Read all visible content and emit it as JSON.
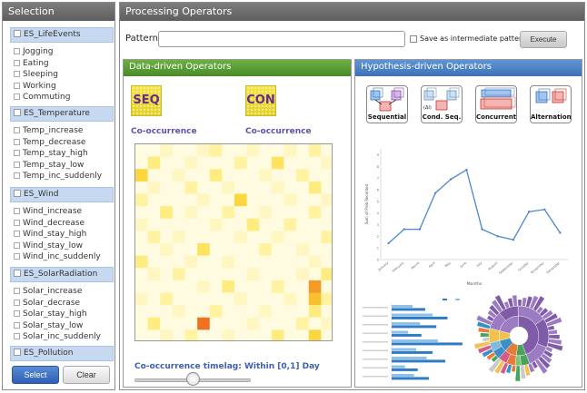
{
  "selection": {
    "title": "Selection",
    "categories": [
      {
        "label": "ES_LifeEvents",
        "items": [
          "Jogging",
          "Eating",
          "Sleeping",
          "Working",
          "Commuting"
        ]
      },
      {
        "label": "ES_Temperature",
        "items": [
          "Temp_increase",
          "Temp_decrease",
          "Temp_stay_high",
          "Temp_stay_low",
          "Temp_inc_suddenly"
        ]
      },
      {
        "label": "ES_Wind",
        "items": [
          "Wind_increase",
          "Wind_decrease",
          "Wind_stay_high",
          "Wind_stay_low",
          "Wind_inc_suddenly"
        ]
      },
      {
        "label": "ES_SolarRadiation",
        "items": [
          "Solar_increase",
          "Solar_decrase",
          "Solar_stay_high",
          "Solar_stay_low",
          "Solar_inc_suddenly"
        ]
      },
      {
        "label": "ES_Pollution",
        "items": []
      }
    ],
    "select_label": "Select",
    "clear_label": "Clear"
  },
  "processing": {
    "title": "Processing Operators",
    "pattern_label": "Pattern:",
    "pattern_value": "",
    "save_label": "Save as intermediate pattern?",
    "execute_label": "Execute"
  },
  "data_driven": {
    "title": "Data-driven Operators",
    "ops": [
      {
        "code": "SEQ",
        "label": "Co-occurrence"
      },
      {
        "code": "CON",
        "label": "Co-occurrence"
      }
    ],
    "timelag_label": "Co-occurrence timelag: Within [0,1] Day",
    "slider_fraction": 0.5
  },
  "hypothesis_driven": {
    "title": "Hypothesis-driven Operators",
    "ops": [
      {
        "label": "Sequential",
        "icon": "sequential-icon"
      },
      {
        "label": "Cond. Seq.",
        "icon": "cond-seq-icon",
        "tag": "(ΔI)"
      },
      {
        "label": "Concurrent",
        "icon": "concurrent-icon"
      },
      {
        "label": "Alternation",
        "icon": "alternation-icon"
      }
    ]
  },
  "chart_data": [
    {
      "type": "line",
      "xlabel": "Months",
      "ylabel": "Sum of Prob Recorded",
      "categories": [
        "January",
        "February",
        "March",
        "April",
        "May",
        "June",
        "July",
        "August",
        "September",
        "October",
        "November",
        "December"
      ],
      "values": [
        1.4,
        2.6,
        2.6,
        5.7,
        6.9,
        7.7,
        2.6,
        2.0,
        1.7,
        4.1,
        4.3,
        2.3
      ],
      "ylim": [
        0,
        9.5
      ],
      "ytick_step": 0.5,
      "color": "#4a86d0"
    },
    {
      "type": "bar",
      "orientation": "horizontal",
      "series": [
        {
          "values": [
            0.28,
            0.55,
            0.38,
            0.22,
            0.62,
            0.33,
            0.47,
            0.18,
            0.3
          ]
        },
        {
          "values": [
            0.45,
            0.75,
            0.6,
            0.4,
            0.95,
            0.55,
            0.72,
            0.35,
            0.5
          ]
        }
      ],
      "colors": [
        "#8fc1e8",
        "#2e7bc6"
      ]
    },
    {
      "type": "sunburst",
      "colors": [
        "#7f5ba8",
        "#9b7cc2",
        "#4aa35a",
        "#e87a3a",
        "#3b8fc7",
        "#c9c9c9",
        "#f2c14e",
        "#d65a8a"
      ]
    }
  ],
  "heatmap": {
    "rows": 16,
    "cols": 16,
    "palette": [
      "#fffbe0",
      "#fff6c2",
      "#fff2a0",
      "#ffec80",
      "#ffe260",
      "#fcd63e",
      "#f8bf2e",
      "#f39a27",
      "#ee7222"
    ],
    "cells": [
      0,
      0,
      1,
      0,
      0,
      1,
      2,
      0,
      0,
      1,
      0,
      0,
      1,
      0,
      2,
      0,
      0,
      3,
      0,
      0,
      1,
      0,
      0,
      0,
      2,
      0,
      0,
      4,
      0,
      0,
      0,
      1,
      5,
      0,
      0,
      1,
      0,
      0,
      3,
      0,
      0,
      0,
      1,
      0,
      0,
      2,
      0,
      0,
      0,
      1,
      0,
      0,
      2,
      0,
      0,
      1,
      0,
      0,
      0,
      1,
      0,
      0,
      3,
      0,
      2,
      0,
      0,
      0,
      0,
      1,
      0,
      0,
      5,
      0,
      0,
      0,
      1,
      0,
      0,
      1,
      0,
      0,
      3,
      0,
      1,
      0,
      0,
      2,
      0,
      0,
      1,
      0,
      0,
      0,
      2,
      0,
      1,
      0,
      0,
      0,
      0,
      0,
      1,
      0,
      0,
      3,
      0,
      0,
      2,
      0,
      0,
      0,
      0,
      2,
      0,
      1,
      0,
      0,
      0,
      0,
      1,
      0,
      0,
      1,
      0,
      0,
      0,
      2,
      0,
      0,
      1,
      0,
      0,
      4,
      0,
      0,
      0,
      0,
      2,
      0,
      0,
      1,
      0,
      0,
      3,
      0,
      0,
      0,
      1,
      0,
      0,
      1,
      0,
      0,
      0,
      0,
      0,
      0,
      1,
      0,
      0,
      1,
      0,
      2,
      0,
      0,
      0,
      0,
      0,
      1,
      0,
      0,
      0,
      1,
      0,
      3,
      0,
      0,
      0,
      0,
      0,
      1,
      0,
      3,
      0,
      0,
      0,
      2,
      0,
      0,
      7,
      0,
      1,
      0,
      2,
      0,
      0,
      0,
      0,
      0,
      1,
      0,
      0,
      0,
      1,
      0,
      6,
      2,
      0,
      0,
      0,
      1,
      0,
      0,
      2,
      0,
      0,
      0,
      1,
      0,
      0,
      0,
      3,
      0,
      0,
      3,
      0,
      0,
      0,
      8,
      0,
      0,
      0,
      1,
      0,
      0,
      0,
      2,
      0,
      1,
      0,
      0,
      1,
      0,
      2,
      0,
      0,
      1,
      0,
      0,
      0,
      3,
      0,
      0,
      5,
      0
    ]
  }
}
